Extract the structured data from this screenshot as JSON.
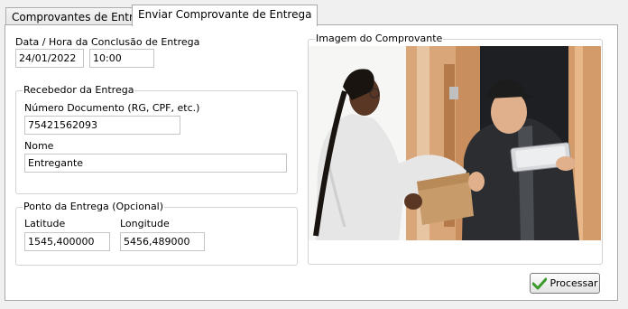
{
  "tabs": [
    {
      "label": "Comprovantes de Entrega"
    },
    {
      "label": "Enviar Comprovante de Entrega"
    }
  ],
  "conclusao": {
    "label": "Data / Hora da Conclusão de Entrega",
    "date": "24/01/2022",
    "time": "10:00"
  },
  "recebedor": {
    "legend": "Recebedor da Entrega",
    "documento_label": "Número Documento (RG, CPF, etc.)",
    "documento_value": "75421562093",
    "nome_label": "Nome",
    "nome_value": "Entregante"
  },
  "ponto": {
    "legend": "Ponto da Entrega (Opcional)",
    "latitude_label": "Latitude",
    "latitude_value": "1545,400000",
    "longitude_label": "Longitude",
    "longitude_value": "5456,489000"
  },
  "imagem": {
    "legend": "Imagem do Comprovante",
    "photo": "delivery-photo"
  },
  "processar_label": "Processar",
  "icons": {
    "processar": "checkmark-icon"
  },
  "colors": {
    "check_green": "#3a9a2a"
  }
}
